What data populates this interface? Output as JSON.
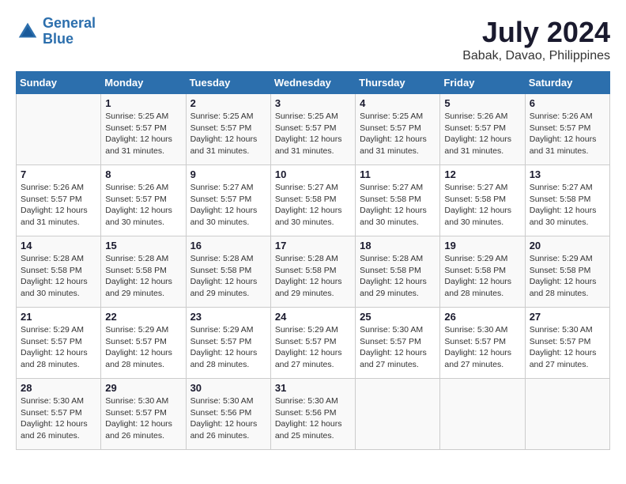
{
  "logo": {
    "line1": "General",
    "line2": "Blue"
  },
  "header": {
    "month": "July 2024",
    "location": "Babak, Davao, Philippines"
  },
  "days_of_week": [
    "Sunday",
    "Monday",
    "Tuesday",
    "Wednesday",
    "Thursday",
    "Friday",
    "Saturday"
  ],
  "weeks": [
    [
      {
        "day": "",
        "info": ""
      },
      {
        "day": "1",
        "info": "Sunrise: 5:25 AM\nSunset: 5:57 PM\nDaylight: 12 hours\nand 31 minutes."
      },
      {
        "day": "2",
        "info": "Sunrise: 5:25 AM\nSunset: 5:57 PM\nDaylight: 12 hours\nand 31 minutes."
      },
      {
        "day": "3",
        "info": "Sunrise: 5:25 AM\nSunset: 5:57 PM\nDaylight: 12 hours\nand 31 minutes."
      },
      {
        "day": "4",
        "info": "Sunrise: 5:25 AM\nSunset: 5:57 PM\nDaylight: 12 hours\nand 31 minutes."
      },
      {
        "day": "5",
        "info": "Sunrise: 5:26 AM\nSunset: 5:57 PM\nDaylight: 12 hours\nand 31 minutes."
      },
      {
        "day": "6",
        "info": "Sunrise: 5:26 AM\nSunset: 5:57 PM\nDaylight: 12 hours\nand 31 minutes."
      }
    ],
    [
      {
        "day": "7",
        "info": "Sunrise: 5:26 AM\nSunset: 5:57 PM\nDaylight: 12 hours\nand 31 minutes."
      },
      {
        "day": "8",
        "info": "Sunrise: 5:26 AM\nSunset: 5:57 PM\nDaylight: 12 hours\nand 30 minutes."
      },
      {
        "day": "9",
        "info": "Sunrise: 5:27 AM\nSunset: 5:57 PM\nDaylight: 12 hours\nand 30 minutes."
      },
      {
        "day": "10",
        "info": "Sunrise: 5:27 AM\nSunset: 5:58 PM\nDaylight: 12 hours\nand 30 minutes."
      },
      {
        "day": "11",
        "info": "Sunrise: 5:27 AM\nSunset: 5:58 PM\nDaylight: 12 hours\nand 30 minutes."
      },
      {
        "day": "12",
        "info": "Sunrise: 5:27 AM\nSunset: 5:58 PM\nDaylight: 12 hours\nand 30 minutes."
      },
      {
        "day": "13",
        "info": "Sunrise: 5:27 AM\nSunset: 5:58 PM\nDaylight: 12 hours\nand 30 minutes."
      }
    ],
    [
      {
        "day": "14",
        "info": "Sunrise: 5:28 AM\nSunset: 5:58 PM\nDaylight: 12 hours\nand 30 minutes."
      },
      {
        "day": "15",
        "info": "Sunrise: 5:28 AM\nSunset: 5:58 PM\nDaylight: 12 hours\nand 29 minutes."
      },
      {
        "day": "16",
        "info": "Sunrise: 5:28 AM\nSunset: 5:58 PM\nDaylight: 12 hours\nand 29 minutes."
      },
      {
        "day": "17",
        "info": "Sunrise: 5:28 AM\nSunset: 5:58 PM\nDaylight: 12 hours\nand 29 minutes."
      },
      {
        "day": "18",
        "info": "Sunrise: 5:28 AM\nSunset: 5:58 PM\nDaylight: 12 hours\nand 29 minutes."
      },
      {
        "day": "19",
        "info": "Sunrise: 5:29 AM\nSunset: 5:58 PM\nDaylight: 12 hours\nand 28 minutes."
      },
      {
        "day": "20",
        "info": "Sunrise: 5:29 AM\nSunset: 5:58 PM\nDaylight: 12 hours\nand 28 minutes."
      }
    ],
    [
      {
        "day": "21",
        "info": "Sunrise: 5:29 AM\nSunset: 5:57 PM\nDaylight: 12 hours\nand 28 minutes."
      },
      {
        "day": "22",
        "info": "Sunrise: 5:29 AM\nSunset: 5:57 PM\nDaylight: 12 hours\nand 28 minutes."
      },
      {
        "day": "23",
        "info": "Sunrise: 5:29 AM\nSunset: 5:57 PM\nDaylight: 12 hours\nand 28 minutes."
      },
      {
        "day": "24",
        "info": "Sunrise: 5:29 AM\nSunset: 5:57 PM\nDaylight: 12 hours\nand 27 minutes."
      },
      {
        "day": "25",
        "info": "Sunrise: 5:30 AM\nSunset: 5:57 PM\nDaylight: 12 hours\nand 27 minutes."
      },
      {
        "day": "26",
        "info": "Sunrise: 5:30 AM\nSunset: 5:57 PM\nDaylight: 12 hours\nand 27 minutes."
      },
      {
        "day": "27",
        "info": "Sunrise: 5:30 AM\nSunset: 5:57 PM\nDaylight: 12 hours\nand 27 minutes."
      }
    ],
    [
      {
        "day": "28",
        "info": "Sunrise: 5:30 AM\nSunset: 5:57 PM\nDaylight: 12 hours\nand 26 minutes."
      },
      {
        "day": "29",
        "info": "Sunrise: 5:30 AM\nSunset: 5:57 PM\nDaylight: 12 hours\nand 26 minutes."
      },
      {
        "day": "30",
        "info": "Sunrise: 5:30 AM\nSunset: 5:56 PM\nDaylight: 12 hours\nand 26 minutes."
      },
      {
        "day": "31",
        "info": "Sunrise: 5:30 AM\nSunset: 5:56 PM\nDaylight: 12 hours\nand 25 minutes."
      },
      {
        "day": "",
        "info": ""
      },
      {
        "day": "",
        "info": ""
      },
      {
        "day": "",
        "info": ""
      }
    ]
  ]
}
